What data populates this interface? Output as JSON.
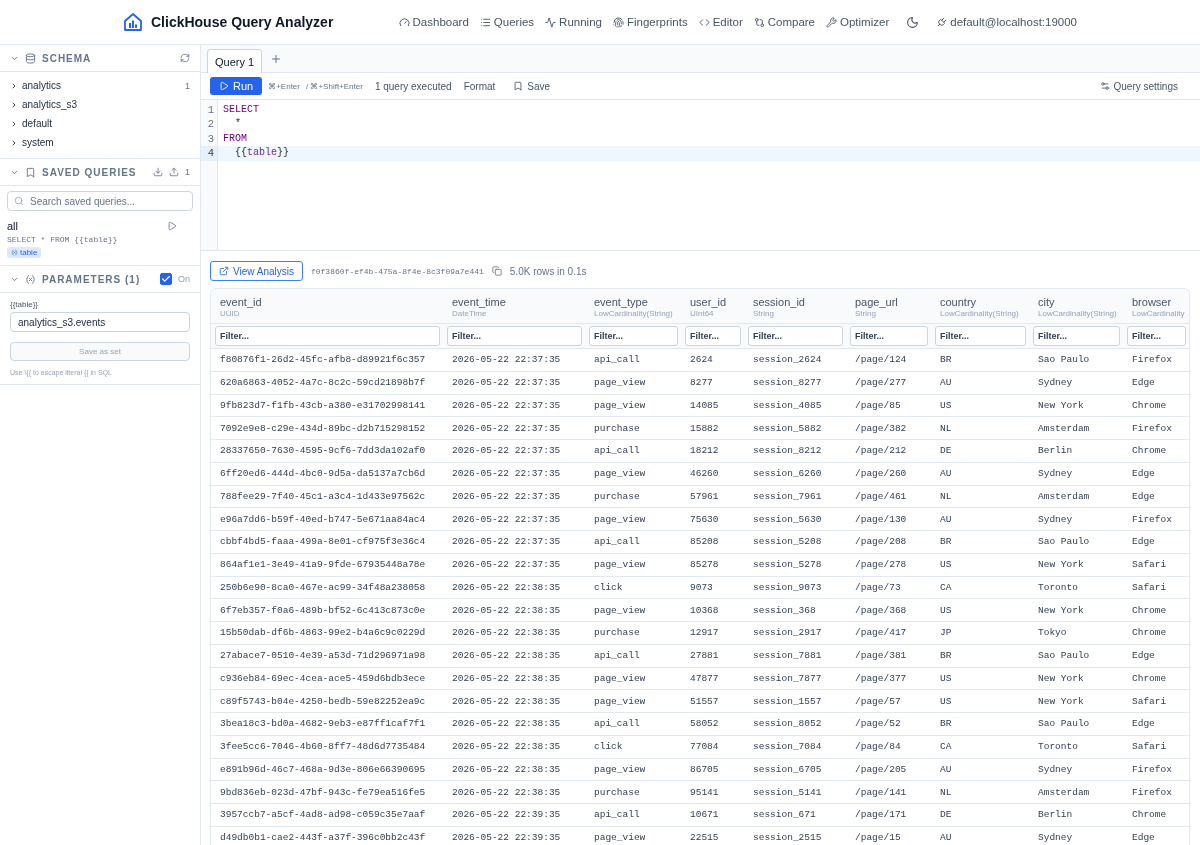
{
  "header": {
    "title": "ClickHouse Query Analyzer",
    "nav": [
      "Dashboard",
      "Queries",
      "Running",
      "Fingerprints",
      "Editor",
      "Compare",
      "Optimizer"
    ],
    "connection": "default@localhost:19000"
  },
  "sidebar": {
    "schema": {
      "title": "SCHEMA",
      "expanded": true,
      "databases": [
        {
          "name": "analytics",
          "expanded": false,
          "count": "1"
        },
        {
          "name": "analytics_s3",
          "expanded": false
        },
        {
          "name": "default",
          "expanded": false
        },
        {
          "name": "system",
          "expanded": false
        }
      ]
    },
    "saved_queries": {
      "title": "SAVED QUERIES",
      "expanded": true,
      "count": "1",
      "search": {
        "placeholder": "Search saved queries..."
      },
      "items": [
        {
          "name": "all",
          "sql": "SELECT * FROM {{table}}",
          "tags": [
            "table"
          ]
        }
      ]
    },
    "parameters": {
      "title": "PARAMETERS (1)",
      "expanded": true,
      "enabled": true,
      "enabled_label": "On",
      "fields": [
        {
          "label": "{{table}}",
          "value": "analytics_s3.events"
        }
      ],
      "save_button": {
        "label": "Save as set",
        "disabled": true
      },
      "hint": "Use \\{{ to escape literal {{ in SQL"
    }
  },
  "tabs": [
    {
      "label": "Query 1",
      "selected": true
    }
  ],
  "toolbar": {
    "run": "Run",
    "shortcuts": [
      "⌘+Enter",
      "/ ⌘+Shift+Enter"
    ],
    "status": "1 query executed",
    "format": "Format",
    "save": "Save",
    "settings": "Query settings"
  },
  "editor": {
    "lines": [
      {
        "number": "1",
        "active": false,
        "tokens": [
          {
            "text": "SELECT",
            "kind": "keyword"
          }
        ]
      },
      {
        "number": "2",
        "active": false,
        "tokens": [
          {
            "text": "  *",
            "kind": "plain"
          }
        ]
      },
      {
        "number": "3",
        "active": false,
        "tokens": [
          {
            "text": "FROM",
            "kind": "keyword"
          }
        ]
      },
      {
        "number": "4",
        "active": true,
        "tokens": [
          {
            "text": "  {{",
            "kind": "plain"
          },
          {
            "text": "table",
            "kind": "variable"
          },
          {
            "text": "}}",
            "kind": "plain"
          }
        ]
      }
    ]
  },
  "results": {
    "view_analysis": "View Analysis",
    "query_id": "f0f3860f-ef4b-475a-8f4e-8c3f09a7e441",
    "summary": "5.0K rows in 0.1s",
    "table": {
      "columns": [
        {
          "name": "event_id",
          "type": "UUID",
          "filter_placeholder": "Filter..."
        },
        {
          "name": "event_time",
          "type": "DateTime",
          "filter_placeholder": "Filter..."
        },
        {
          "name": "event_type",
          "type": "LowCardinality(String)",
          "filter_placeholder": "Filter..."
        },
        {
          "name": "user_id",
          "type": "UInt64",
          "filter_placeholder": "Filter..."
        },
        {
          "name": "session_id",
          "type": "String",
          "filter_placeholder": "Filter..."
        },
        {
          "name": "page_url",
          "type": "String",
          "filter_placeholder": "Filter..."
        },
        {
          "name": "country",
          "type": "LowCardinality(String)",
          "filter_placeholder": "Filter..."
        },
        {
          "name": "city",
          "type": "LowCardinality(String)",
          "filter_placeholder": "Filter..."
        },
        {
          "name": "browser",
          "type": "LowCardinality",
          "filter_placeholder": "Filter..."
        }
      ],
      "rows": [
        [
          "f80876f1-26d2-45fc-afb8-d89921f6c357",
          "2026-05-22 22:37:35",
          "api_call",
          "2624",
          "session_2624",
          "/page/124",
          "BR",
          "Sao Paulo",
          "Firefox"
        ],
        [
          "620a6863-4052-4a7c-8c2c-59cd21898b7f",
          "2026-05-22 22:37:35",
          "page_view",
          "8277",
          "session_8277",
          "/page/277",
          "AU",
          "Sydney",
          "Edge"
        ],
        [
          "9fb823d7-f1fb-43cb-a380-e31702998141",
          "2026-05-22 22:37:35",
          "page_view",
          "14085",
          "session_4085",
          "/page/85",
          "US",
          "New York",
          "Chrome"
        ],
        [
          "7092e9e8-c29e-434d-89bc-d2b715298152",
          "2026-05-22 22:37:35",
          "purchase",
          "15882",
          "session_5882",
          "/page/382",
          "NL",
          "Amsterdam",
          "Firefox"
        ],
        [
          "28337650-7630-4595-9cf6-7dd3da102af0",
          "2026-05-22 22:37:35",
          "api_call",
          "18212",
          "session_8212",
          "/page/212",
          "DE",
          "Berlin",
          "Chrome"
        ],
        [
          "6ff20ed6-444d-4bc0-9d5a-da5137a7cb6d",
          "2026-05-22 22:37:35",
          "page_view",
          "46260",
          "session_6260",
          "/page/260",
          "AU",
          "Sydney",
          "Edge"
        ],
        [
          "788fee29-7f40-45c1-a3c4-1d433e97562c",
          "2026-05-22 22:37:35",
          "purchase",
          "57961",
          "session_7961",
          "/page/461",
          "NL",
          "Amsterdam",
          "Edge"
        ],
        [
          "e96a7dd6-b59f-40ed-b747-5e671aa84ac4",
          "2026-05-22 22:37:35",
          "page_view",
          "75630",
          "session_5630",
          "/page/130",
          "AU",
          "Sydney",
          "Firefox"
        ],
        [
          "cbbf4bd5-faaa-499a-8e01-cf975f3e36c4",
          "2026-05-22 22:37:35",
          "api_call",
          "85208",
          "session_5208",
          "/page/208",
          "BR",
          "Sao Paulo",
          "Edge"
        ],
        [
          "864af1e1-3e49-41a9-9fde-67935448a78e",
          "2026-05-22 22:37:35",
          "page_view",
          "85278",
          "session_5278",
          "/page/278",
          "US",
          "New York",
          "Safari"
        ],
        [
          "250b6e90-8ca0-467e-ac99-34f48a238058",
          "2026-05-22 22:38:35",
          "click",
          "9073",
          "session_9073",
          "/page/73",
          "CA",
          "Toronto",
          "Safari"
        ],
        [
          "6f7eb357-f0a6-489b-bf52-6c413c873c0e",
          "2026-05-22 22:38:35",
          "page_view",
          "10368",
          "session_368",
          "/page/368",
          "US",
          "New York",
          "Chrome"
        ],
        [
          "15b50dab-df6b-4863-99e2-b4a6c9c0229d",
          "2026-05-22 22:38:35",
          "purchase",
          "12917",
          "session_2917",
          "/page/417",
          "JP",
          "Tokyo",
          "Chrome"
        ],
        [
          "27abace7-0510-4e39-a53d-71d296971a98",
          "2026-05-22 22:38:35",
          "api_call",
          "27881",
          "session_7881",
          "/page/381",
          "BR",
          "Sao Paulo",
          "Edge"
        ],
        [
          "c936eb84-69ec-4cea-ace5-459d6bdb3ece",
          "2026-05-22 22:38:35",
          "page_view",
          "47877",
          "session_7877",
          "/page/377",
          "US",
          "New York",
          "Chrome"
        ],
        [
          "c89f5743-b04e-4250-bedb-59e82252ea9c",
          "2026-05-22 22:38:35",
          "page_view",
          "51557",
          "session_1557",
          "/page/57",
          "US",
          "New York",
          "Safari"
        ],
        [
          "3bea18c3-bd0a-4682-9eb3-e87ff1caf7f1",
          "2026-05-22 22:38:35",
          "api_call",
          "58052",
          "session_8052",
          "/page/52",
          "BR",
          "Sao Paulo",
          "Edge"
        ],
        [
          "3fee5cc6-7046-4b60-8ff7-48d6d7735484",
          "2026-05-22 22:38:35",
          "click",
          "77084",
          "session_7084",
          "/page/84",
          "CA",
          "Toronto",
          "Safari"
        ],
        [
          "e891b96d-46c7-468a-9d3e-806e66390695",
          "2026-05-22 22:38:35",
          "page_view",
          "86705",
          "session_6705",
          "/page/205",
          "AU",
          "Sydney",
          "Firefox"
        ],
        [
          "9bd836eb-023d-47bf-943c-fe79ea516fe5",
          "2026-05-22 22:38:35",
          "purchase",
          "95141",
          "session_5141",
          "/page/141",
          "NL",
          "Amsterdam",
          "Firefox"
        ],
        [
          "3957ccb7-a5cf-4ad8-ad98-c059c35e7aaf",
          "2026-05-22 22:39:35",
          "api_call",
          "10671",
          "session_671",
          "/page/171",
          "DE",
          "Berlin",
          "Chrome"
        ],
        [
          "d49db0b1-cae2-443f-a37f-396c0bb2c43f",
          "2026-05-22 22:39:35",
          "page_view",
          "22515",
          "session_2515",
          "/page/15",
          "AU",
          "Sydney",
          "Edge"
        ]
      ]
    }
  }
}
